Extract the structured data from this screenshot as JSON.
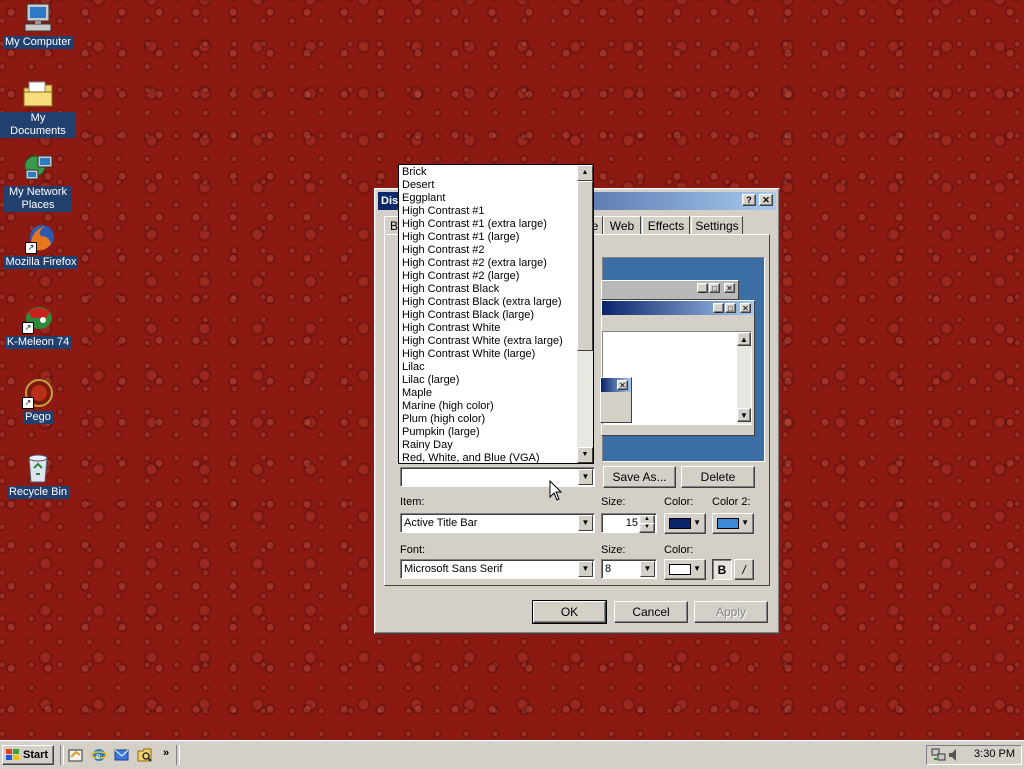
{
  "desktop": {
    "icons": [
      {
        "label": "My Computer",
        "icon": "computer-icon"
      },
      {
        "label": "My Documents",
        "icon": "folder-icon"
      },
      {
        "label": "My Network Places",
        "icon": "network-icon"
      },
      {
        "label": "Mozilla Firefox",
        "icon": "firefox-icon"
      },
      {
        "label": "K-Meleon 74",
        "icon": "k-meleon-icon"
      },
      {
        "label": "Pego",
        "icon": "pego-icon"
      },
      {
        "label": "Recycle Bin",
        "icon": "recycle-bin-icon"
      }
    ],
    "wallpaper_color": "#8c1a12"
  },
  "dialog": {
    "title": "Dis",
    "tabs": {
      "partial": "B",
      "appearance_partial": "e",
      "web": "Web",
      "effects": "Effects",
      "settings": "Settings"
    },
    "scheme_value": "",
    "save_as_label": "Save As...",
    "delete_label": "Delete",
    "item_label": "Item:",
    "item_value": "Active Title Bar",
    "size_label": "Size:",
    "size_value": "15",
    "color_label": "Color:",
    "color2_label": "Color 2:",
    "color_value": "#0a246a",
    "color2_value": "#3a8ad8",
    "font_label": "Font:",
    "font_value": "Microsoft Sans Serif",
    "font_size_label": "Size:",
    "font_size_value": "8",
    "font_color_label": "Color:",
    "font_color_value": "#ffffff",
    "bold_label": "B",
    "italic_label": "/",
    "ok_label": "OK",
    "cancel_label": "Cancel",
    "apply_label": "Apply"
  },
  "scheme_list": {
    "items": [
      "Brick",
      "Desert",
      "Eggplant",
      "High Contrast #1",
      "High Contrast #1 (extra large)",
      "High Contrast #1 (large)",
      "High Contrast #2",
      "High Contrast #2 (extra large)",
      "High Contrast #2 (large)",
      "High Contrast Black",
      "High Contrast Black (extra large)",
      "High Contrast Black (large)",
      "High Contrast White",
      "High Contrast White (extra large)",
      "High Contrast White (large)",
      "Lilac",
      "Lilac (large)",
      "Maple",
      "Marine (high color)",
      "Plum (high color)",
      "Pumpkin (large)",
      "Rainy Day",
      "Red, White, and Blue (VGA)"
    ]
  },
  "taskbar": {
    "start_label": "Start",
    "chevron": "»",
    "clock": "3:30 PM",
    "quick_launch": [
      "desktop-icon",
      "ie-icon",
      "outlook-icon",
      "explorer-icon"
    ]
  }
}
